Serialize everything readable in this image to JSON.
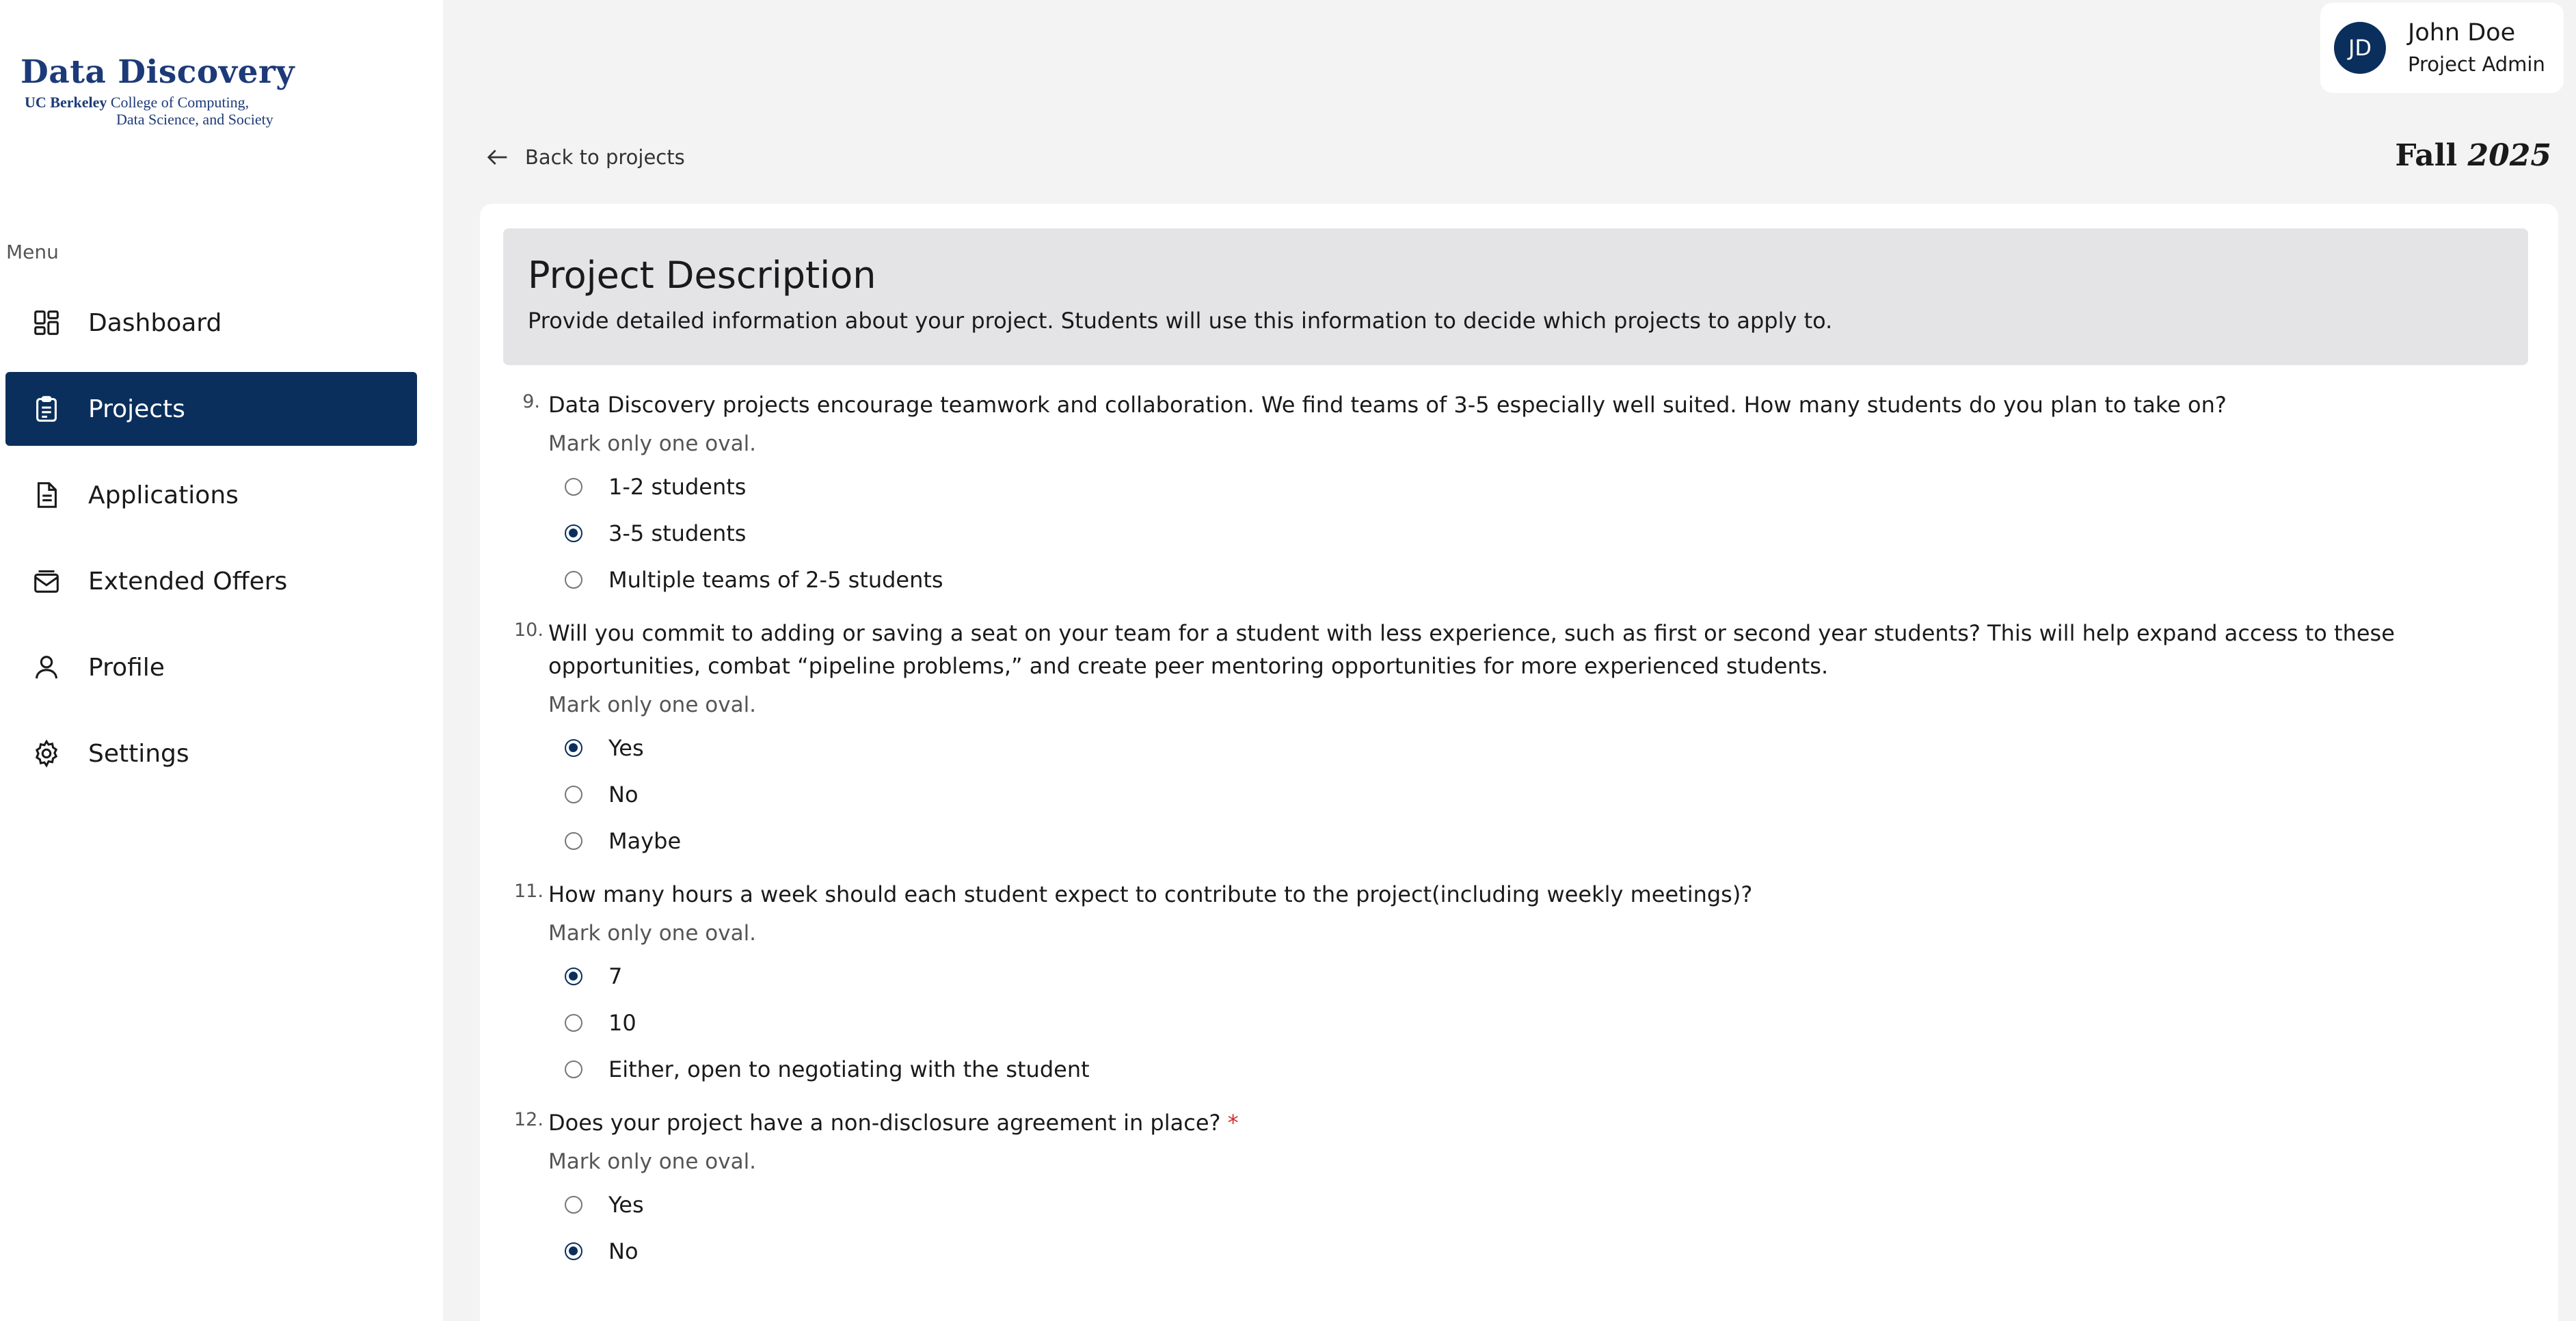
{
  "logo": {
    "title": "Data Discovery",
    "org": "UC Berkeley",
    "line1_rest": "College of Computing,",
    "line2": "Data Science, and Society"
  },
  "sidebar": {
    "menu_label": "Menu",
    "items": [
      {
        "label": "Dashboard",
        "icon": "dashboard-icon",
        "active": false
      },
      {
        "label": "Projects",
        "icon": "clipboard-icon",
        "active": true
      },
      {
        "label": "Applications",
        "icon": "document-icon",
        "active": false
      },
      {
        "label": "Extended Offers",
        "icon": "mail-stack-icon",
        "active": false
      },
      {
        "label": "Profile",
        "icon": "user-icon",
        "active": false
      },
      {
        "label": "Settings",
        "icon": "gear-icon",
        "active": false
      }
    ]
  },
  "user": {
    "initials": "JD",
    "name": "John Doe",
    "role": "Project Admin"
  },
  "header": {
    "back_label": "Back to projects",
    "term_season": "Fall",
    "term_year": "2025"
  },
  "card": {
    "title": "Project Description",
    "description": "Provide detailed information about your project. Students will use this information to decide which projects to apply to."
  },
  "questions": [
    {
      "number": "9.",
      "text": "Data Discovery projects encourage teamwork and collaboration. We find teams of 3-5 especially well suited. How many students do you plan to take on?",
      "required": false,
      "hint": "Mark only one oval.",
      "options": [
        "1-2 students",
        "3-5 students",
        "Multiple teams of 2-5 students"
      ],
      "selected": 1
    },
    {
      "number": "10.",
      "text": "Will you commit to adding or saving a seat on your team for a student with less experience, such as first or second year students? This will help expand access to these opportunities, combat “pipeline problems,” and create peer mentoring opportunities for more experienced students.",
      "required": false,
      "hint": "Mark only one oval.",
      "options": [
        "Yes",
        "No",
        "Maybe"
      ],
      "selected": 0
    },
    {
      "number": "11.",
      "text": "How many hours a week should each student expect to contribute to the project(including weekly meetings)?",
      "required": false,
      "hint": "Mark only one oval.",
      "options": [
        "7",
        "10",
        "Either, open to negotiating with the student"
      ],
      "selected": 0
    },
    {
      "number": "12.",
      "text": "Does your project have a non-disclosure agreement in place?",
      "required": true,
      "required_mark": "*",
      "hint": "Mark only one oval.",
      "options": [
        "Yes",
        "No"
      ],
      "selected": 1
    }
  ],
  "colors": {
    "primary": "#0b2f5c",
    "logo_blue": "#1d3a78",
    "required": "#d32f2f",
    "page_bg": "#f3f3f3",
    "header_bg": "#e4e4e7"
  }
}
